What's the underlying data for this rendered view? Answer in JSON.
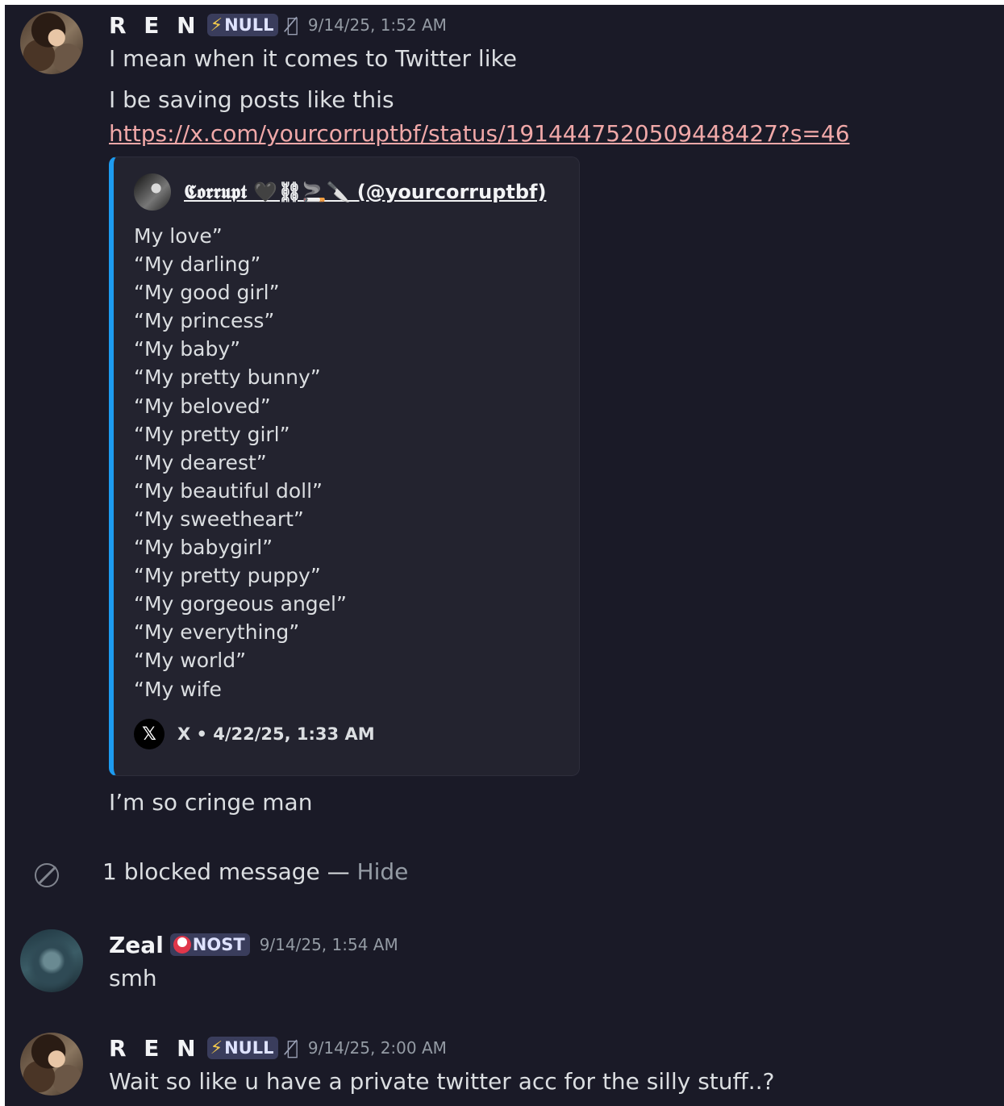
{
  "messages": [
    {
      "username": "R E N",
      "tag": "NULL",
      "timestamp": "9/14/25, 1:52 AM",
      "lines": [
        "I mean when it comes to Twitter like",
        "I be saving posts like this"
      ],
      "link": "https://x.com/yourcorruptbf/status/1914447520509448427?s=46",
      "after_embed": "I’m so cringe man"
    },
    {
      "username": "Zeal",
      "tag": "NOST",
      "timestamp": "9/14/25, 1:54 AM",
      "text": "smh"
    },
    {
      "username": "R E N",
      "tag": "NULL",
      "timestamp": "9/14/25, 2:00 AM",
      "text": "Wait so like u have a private twitter acc for the silly stuff..?"
    }
  ],
  "embed": {
    "author": "𝕮𝖔𝖗𝖗𝖚𝖕𝖙 🖤⛓🚬🔪 (@yourcorruptbf)",
    "lines": [
      "My love”",
      "“My darling”",
      "“My good girl”",
      "“My princess”",
      "“My baby”",
      "“My pretty bunny”",
      "“My beloved”",
      "“My pretty girl”",
      "“My dearest”",
      "“My beautiful doll”",
      "“My sweetheart”",
      "“My babygirl”",
      "“My pretty puppy”",
      "“My gorgeous angel”",
      "“My everything”",
      "“My world”",
      "“My wife"
    ],
    "footer": "X • 4/22/25, 1:33 AM",
    "accent_color": "#1d9bf0"
  },
  "blocked": {
    "text": "1 blocked message — ",
    "action": "Hide"
  },
  "icons": {
    "mute": "muted-mic-icon",
    "x_logo": "x-logo-icon",
    "blocked": "blocked-icon"
  }
}
